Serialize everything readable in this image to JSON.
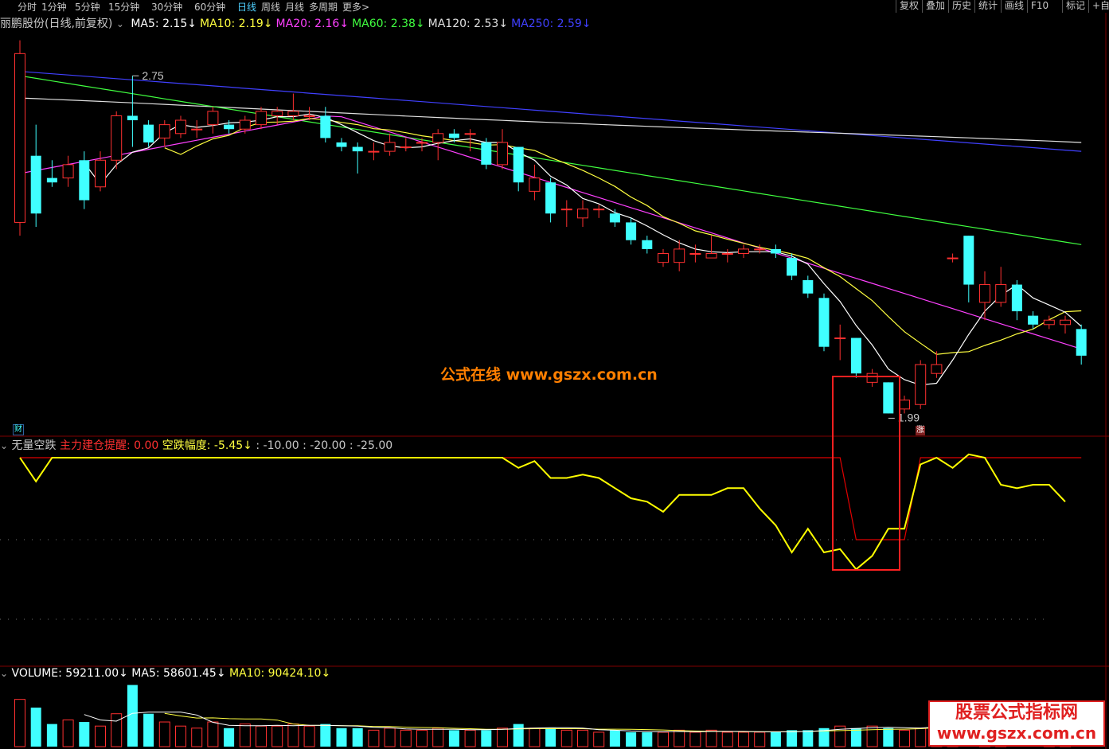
{
  "toolbar": {
    "periods": [
      "分时",
      "1分钟",
      "5分钟",
      "15分钟",
      "30分钟",
      "60分钟",
      "日线",
      "周线",
      "月线",
      "多周期",
      "更多>"
    ],
    "active_period": "日线",
    "tools": [
      "复权",
      "叠加",
      "历史",
      "统计",
      "画线",
      "F10",
      "标记",
      "+自"
    ]
  },
  "price_panel": {
    "title": "丽鹏股份(日线,前复权)",
    "ma": [
      {
        "label": "MA5: 2.15",
        "color": "#ffffff"
      },
      {
        "label": "MA10: 2.19",
        "color": "#ffff40"
      },
      {
        "label": "MA20: 2.16",
        "color": "#ff40ff"
      },
      {
        "label": "MA60: 2.38",
        "color": "#40ff40"
      },
      {
        "label": "MA120: 2.53",
        "color": "#e0e0e0"
      },
      {
        "label": "MA250: 2.59",
        "color": "#4040ff"
      }
    ],
    "high_label": "2.75",
    "low_label": "1.99",
    "fin_tag": "财",
    "zhang_tag": "涨"
  },
  "indicator_panel": {
    "name": "无量空跌",
    "line1": "主力建仓提醒: 0.00",
    "line2": "空跌幅度: -5.45",
    "levels": ": -10.00 : -20.00 : -25.00"
  },
  "volume_panel": {
    "volume": "VOLUME: 59211.00",
    "ma5": "MA5: 58601.45",
    "ma10": "MA10: 90424.10"
  },
  "watermark": {
    "center": "公式在线  www.gszx.com.cn",
    "badge_line1": "股票公式指标网",
    "badge_line2": "www.gszx.com.cn"
  },
  "colors": {
    "up": "#ff3030",
    "down": "#40ffff",
    "ma5": "#ffffff",
    "ma10": "#ffff40",
    "ma20": "#ff40ff",
    "ma60": "#40ff40",
    "ma120": "#e0e0e0",
    "ma250": "#4040ff",
    "signal": "#e00000",
    "spread": "#ffff00"
  },
  "chart_data": {
    "type": "candlestick",
    "y_range": [
      1.99,
      2.75
    ],
    "candles": [
      {
        "o": 2.42,
        "c": 2.8,
        "h": 2.83,
        "l": 2.39
      },
      {
        "o": 2.57,
        "c": 2.44,
        "h": 2.64,
        "l": 2.41
      },
      {
        "o": 2.52,
        "c": 2.51,
        "h": 2.56,
        "l": 2.5
      },
      {
        "o": 2.52,
        "c": 2.55,
        "h": 2.57,
        "l": 2.5
      },
      {
        "o": 2.56,
        "c": 2.47,
        "h": 2.58,
        "l": 2.45
      },
      {
        "o": 2.5,
        "c": 2.56,
        "h": 2.58,
        "l": 2.49
      },
      {
        "o": 2.56,
        "c": 2.66,
        "h": 2.67,
        "l": 2.54
      },
      {
        "o": 2.66,
        "c": 2.65,
        "h": 2.75,
        "l": 2.59
      },
      {
        "o": 2.64,
        "c": 2.6,
        "h": 2.65,
        "l": 2.59
      },
      {
        "o": 2.61,
        "c": 2.64,
        "h": 2.65,
        "l": 2.59
      },
      {
        "o": 2.62,
        "c": 2.65,
        "h": 2.66,
        "l": 2.61
      },
      {
        "o": 2.63,
        "c": 2.63,
        "h": 2.65,
        "l": 2.61
      },
      {
        "o": 2.64,
        "c": 2.67,
        "h": 2.68,
        "l": 2.62
      },
      {
        "o": 2.64,
        "c": 2.63,
        "h": 2.65,
        "l": 2.62
      },
      {
        "o": 2.63,
        "c": 2.65,
        "h": 2.66,
        "l": 2.62
      },
      {
        "o": 2.64,
        "c": 2.67,
        "h": 2.68,
        "l": 2.63
      },
      {
        "o": 2.66,
        "c": 2.67,
        "h": 2.68,
        "l": 2.64
      },
      {
        "o": 2.66,
        "c": 2.67,
        "h": 2.71,
        "l": 2.65
      },
      {
        "o": 2.66,
        "c": 2.66,
        "h": 2.68,
        "l": 2.65
      },
      {
        "o": 2.66,
        "c": 2.61,
        "h": 2.68,
        "l": 2.6
      },
      {
        "o": 2.6,
        "c": 2.59,
        "h": 2.61,
        "l": 2.58
      },
      {
        "o": 2.59,
        "c": 2.58,
        "h": 2.6,
        "l": 2.53
      },
      {
        "o": 2.58,
        "c": 2.58,
        "h": 2.6,
        "l": 2.56
      },
      {
        "o": 2.58,
        "c": 2.6,
        "h": 2.62,
        "l": 2.57
      },
      {
        "o": 2.59,
        "c": 2.59,
        "h": 2.61,
        "l": 2.58
      },
      {
        "o": 2.6,
        "c": 2.6,
        "h": 2.61,
        "l": 2.58
      },
      {
        "o": 2.6,
        "c": 2.62,
        "h": 2.63,
        "l": 2.56
      },
      {
        "o": 2.62,
        "c": 2.61,
        "h": 2.63,
        "l": 2.6
      },
      {
        "o": 2.62,
        "c": 2.62,
        "h": 2.63,
        "l": 2.58
      },
      {
        "o": 2.6,
        "c": 2.55,
        "h": 2.61,
        "l": 2.54
      },
      {
        "o": 2.55,
        "c": 2.6,
        "h": 2.63,
        "l": 2.54
      },
      {
        "o": 2.59,
        "c": 2.51,
        "h": 2.59,
        "l": 2.49
      },
      {
        "o": 2.49,
        "c": 2.52,
        "h": 2.55,
        "l": 2.47
      },
      {
        "o": 2.51,
        "c": 2.44,
        "h": 2.52,
        "l": 2.42
      },
      {
        "o": 2.45,
        "c": 2.45,
        "h": 2.47,
        "l": 2.41
      },
      {
        "o": 2.43,
        "c": 2.45,
        "h": 2.47,
        "l": 2.41
      },
      {
        "o": 2.45,
        "c": 2.45,
        "h": 2.46,
        "l": 2.43
      },
      {
        "o": 2.44,
        "c": 2.42,
        "h": 2.45,
        "l": 2.41
      },
      {
        "o": 2.42,
        "c": 2.38,
        "h": 2.43,
        "l": 2.37
      },
      {
        "o": 2.38,
        "c": 2.36,
        "h": 2.39,
        "l": 2.35
      },
      {
        "o": 2.33,
        "c": 2.35,
        "h": 2.36,
        "l": 2.32
      },
      {
        "o": 2.33,
        "c": 2.36,
        "h": 2.38,
        "l": 2.31
      },
      {
        "o": 2.35,
        "c": 2.35,
        "h": 2.37,
        "l": 2.33
      },
      {
        "o": 2.34,
        "c": 2.35,
        "h": 2.39,
        "l": 2.34
      },
      {
        "o": 2.35,
        "c": 2.35,
        "h": 2.36,
        "l": 2.33
      },
      {
        "o": 2.35,
        "c": 2.36,
        "h": 2.37,
        "l": 2.34
      },
      {
        "o": 2.36,
        "c": 2.36,
        "h": 2.37,
        "l": 2.35
      },
      {
        "o": 2.36,
        "c": 2.35,
        "h": 2.37,
        "l": 2.34
      },
      {
        "o": 2.34,
        "c": 2.3,
        "h": 2.35,
        "l": 2.29
      },
      {
        "o": 2.29,
        "c": 2.26,
        "h": 2.3,
        "l": 2.25
      },
      {
        "o": 2.25,
        "c": 2.14,
        "h": 2.26,
        "l": 2.13
      },
      {
        "o": 2.16,
        "c": 2.16,
        "h": 2.19,
        "l": 2.11
      },
      {
        "o": 2.16,
        "c": 2.08,
        "h": 2.16,
        "l": 2.07
      },
      {
        "o": 2.06,
        "c": 2.08,
        "h": 2.09,
        "l": 2.05
      },
      {
        "o": 2.06,
        "c": 1.99,
        "h": 2.06,
        "l": 1.99
      },
      {
        "o": 2.0,
        "c": 2.02,
        "h": 2.03,
        "l": 1.99
      },
      {
        "o": 2.01,
        "c": 2.1,
        "h": 2.11,
        "l": 2.0
      },
      {
        "o": 2.08,
        "c": 2.1,
        "h": 2.13,
        "l": 2.07
      },
      {
        "o": 2.34,
        "c": 2.34,
        "h": 2.35,
        "l": 2.33
      },
      {
        "o": 2.39,
        "c": 2.28,
        "h": 2.39,
        "l": 2.24
      },
      {
        "o": 2.24,
        "c": 2.28,
        "h": 2.31,
        "l": 2.2
      },
      {
        "o": 2.24,
        "c": 2.28,
        "h": 2.32,
        "l": 2.23
      },
      {
        "o": 2.28,
        "c": 2.22,
        "h": 2.29,
        "l": 2.2
      },
      {
        "o": 2.21,
        "c": 2.19,
        "h": 2.22,
        "l": 2.18
      },
      {
        "o": 2.19,
        "c": 2.2,
        "h": 2.21,
        "l": 2.18
      },
      {
        "o": 2.19,
        "c": 2.2,
        "h": 2.21,
        "l": 2.17
      },
      {
        "o": 2.18,
        "c": 2.12,
        "h": 2.19,
        "l": 2.1
      }
    ],
    "volume": [
      46000,
      38000,
      22000,
      26000,
      24000,
      20000,
      32000,
      60000,
      32000,
      24000,
      20000,
      18000,
      24000,
      18000,
      22000,
      20000,
      20000,
      22000,
      20000,
      22000,
      18000,
      18000,
      16000,
      18000,
      16000,
      16000,
      18000,
      16000,
      16000,
      16000,
      18000,
      22000,
      18000,
      18000,
      16000,
      16000,
      14000,
      16000,
      14000,
      14000,
      14000,
      16000,
      14000,
      16000,
      14000,
      14000,
      14000,
      14000,
      16000,
      16000,
      18000,
      20000,
      18000,
      20000,
      18000,
      16000,
      18000,
      24000,
      30000,
      30000,
      24000,
      20000,
      18000,
      16000,
      16000,
      18000,
      14000
    ],
    "indicator_spread": [
      0.0,
      -3.5,
      0.0,
      0.0,
      0.0,
      0.0,
      0.0,
      0.0,
      0.0,
      0.0,
      0.0,
      0.0,
      0.0,
      0.0,
      0.0,
      0.0,
      0.0,
      0.0,
      0.0,
      0.0,
      0.0,
      0.0,
      0.0,
      0.0,
      0.0,
      0.0,
      0.0,
      0.0,
      0.0,
      0.0,
      0.0,
      -1.5,
      -0.5,
      -3.0,
      -3.0,
      -2.5,
      -3.0,
      -4.5,
      -6.0,
      -6.5,
      -8.0,
      -5.5,
      -5.5,
      -5.5,
      -4.5,
      -4.5,
      -7.5,
      -10.0,
      -14.0,
      -10.5,
      -14.0,
      -13.5,
      -16.5,
      -14.5,
      -10.5,
      -10.5,
      -1.0,
      0.0,
      -1.5,
      0.5,
      0.0,
      -4.0,
      -4.5,
      -4.0,
      -4.0,
      -6.5
    ],
    "indicator_signal": [
      1,
      1,
      1,
      1,
      1,
      1,
      1,
      1,
      1,
      1,
      1,
      1,
      1,
      1,
      1,
      1,
      1,
      1,
      1,
      1,
      1,
      1,
      1,
      1,
      1,
      1,
      1,
      1,
      1,
      1,
      1,
      1,
      1,
      1,
      1,
      1,
      1,
      1,
      1,
      1,
      1,
      1,
      1,
      1,
      1,
      1,
      1,
      1,
      1,
      1,
      1,
      1,
      0,
      0,
      0,
      0,
      1,
      1,
      1,
      1,
      1,
      1,
      1,
      1,
      1,
      1,
      1
    ]
  }
}
